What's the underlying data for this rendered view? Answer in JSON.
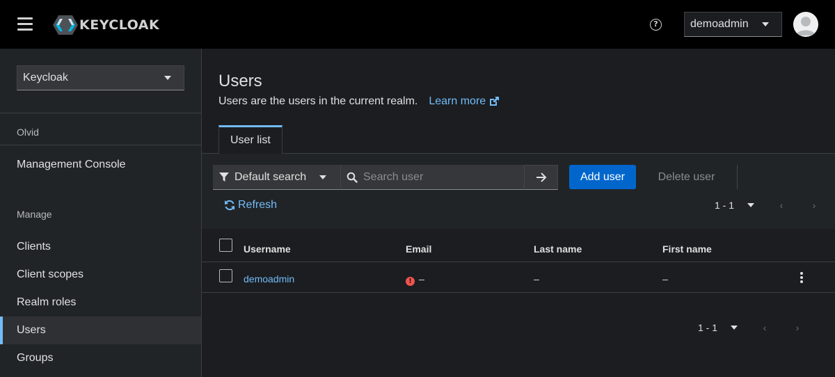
{
  "header": {
    "logo_text": "KEYCLOAK",
    "user_menu_label": "demoadmin"
  },
  "sidebar": {
    "realm_select": "Keycloak",
    "section_realm": "Olvid",
    "management_console": "Management Console",
    "section_manage": "Manage",
    "items": [
      {
        "label": "Clients",
        "active": false
      },
      {
        "label": "Client scopes",
        "active": false
      },
      {
        "label": "Realm roles",
        "active": false
      },
      {
        "label": "Users",
        "active": true
      },
      {
        "label": "Groups",
        "active": false
      }
    ]
  },
  "main": {
    "title": "Users",
    "description": "Users are the users in the current realm.",
    "learn_more": "Learn more",
    "tabs": [
      {
        "label": "User list",
        "active": true
      }
    ],
    "toolbar": {
      "filter_label": "Default search",
      "search_placeholder": "Search user",
      "add_user": "Add user",
      "delete_user": "Delete user",
      "refresh": "Refresh",
      "pagination": "1 - 1"
    },
    "table": {
      "columns": [
        "Username",
        "Email",
        "Last name",
        "First name"
      ],
      "rows": [
        {
          "username": "demoadmin",
          "email": "–",
          "last_name": "–",
          "first_name": "–",
          "email_warning": true
        }
      ]
    },
    "bottom_pagination": "1 - 1"
  },
  "colors": {
    "accent": "#0066cc",
    "link": "#73bcf7",
    "danger": "#f0544d",
    "masthead": "#000000"
  }
}
